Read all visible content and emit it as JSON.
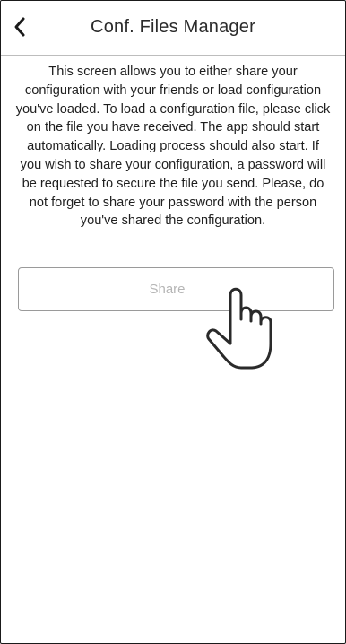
{
  "header": {
    "title": "Conf. Files Manager",
    "back_icon": "chevron-left-icon"
  },
  "main": {
    "description": "This screen allows you to either share your configuration with your friends or load configuration you've loaded. To load a configuration file, please click on the file you have received. The app should start automatically. Loading process should also start. If you wish to share your configuration, a password will be requested to secure the file you send. Please, do not forget to share your password with the person you've shared the configuration.",
    "share_button_label": "Share",
    "pointer_icon": "hand-pointer-icon"
  },
  "colors": {
    "border": "#1a1a1a",
    "divider": "#bdbdbd",
    "button_border": "#9a9a9a",
    "button_text": "#b5b5b5",
    "text": "#1f1f1f"
  }
}
